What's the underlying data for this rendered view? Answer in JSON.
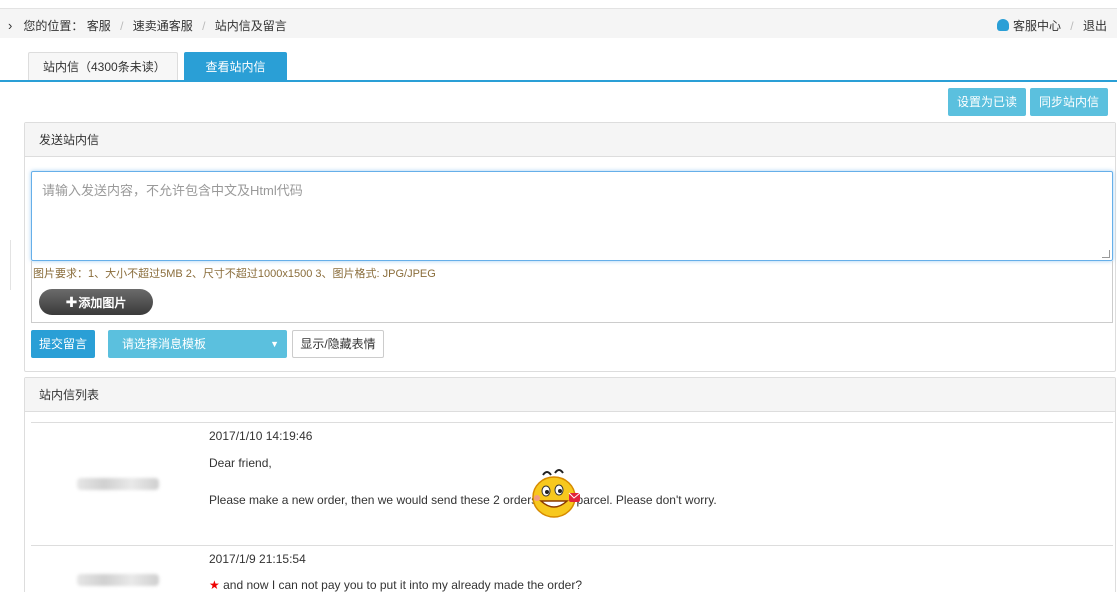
{
  "breadcrumb": {
    "prefix": "您的位置：",
    "items": [
      "客服",
      "速卖通客服",
      "站内信及留言"
    ]
  },
  "toplinks": {
    "service_center": "客服中心",
    "logout": "退出"
  },
  "tabs": [
    {
      "label": "站内信（4300条未读）"
    },
    {
      "label": "查看站内信",
      "close": "✖"
    }
  ],
  "actions": {
    "mark_read": "设置为已读",
    "sync": "同步站内信"
  },
  "send_panel": {
    "title": "发送站内信",
    "placeholder": "请输入发送内容，不允许包含中文及Html代码",
    "image_requirements": "图片要求：1、大小不超过5MB   2、尺寸不超过1000x1500   3、图片格式: JPG/JPEG",
    "add_image": "添加图片",
    "add_image_plus": "✚",
    "submit": "提交留言",
    "template_placeholder": "请选择消息模板",
    "template_caret": "▼",
    "toggle_emoji": "显示/隐藏表情"
  },
  "list_panel": {
    "title": "站内信列表",
    "messages": [
      {
        "time": "2017/1/10 14:19:46",
        "greeting": "Dear friend,",
        "body": "Please make a new order, then we would send these 2 orders in one parcel. Please don't worry."
      },
      {
        "time": "2017/1/9 21:15:54",
        "star": "★",
        "body": "and now I can not pay you to put it into my already made the order?"
      }
    ]
  },
  "colors": {
    "primary": "#2a9fd6",
    "info": "#5bc0de",
    "warning_text": "#8a6d3b"
  }
}
